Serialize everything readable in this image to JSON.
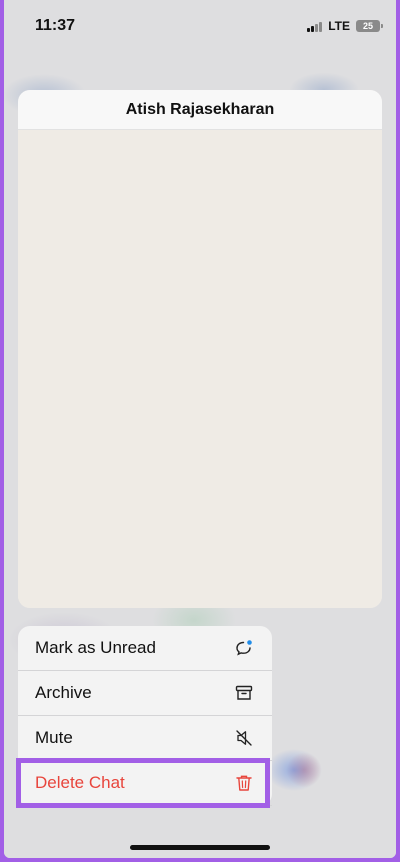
{
  "status_bar": {
    "time": "11:37",
    "network": "LTE",
    "battery_level": "25"
  },
  "preview": {
    "contact_name": "Atish Rajasekharan"
  },
  "context_menu": {
    "items": [
      {
        "label": "Mark as Unread",
        "icon": "unread-bubble-icon"
      },
      {
        "label": "Archive",
        "icon": "archive-box-icon"
      },
      {
        "label": "Mute",
        "icon": "speaker-muted-icon"
      },
      {
        "label": "Delete Chat",
        "icon": "trash-icon",
        "destructive": true
      }
    ]
  },
  "colors": {
    "highlight": "#a25fe6",
    "destructive": "#e8453c",
    "notification_dot": "#1f8ce9"
  }
}
